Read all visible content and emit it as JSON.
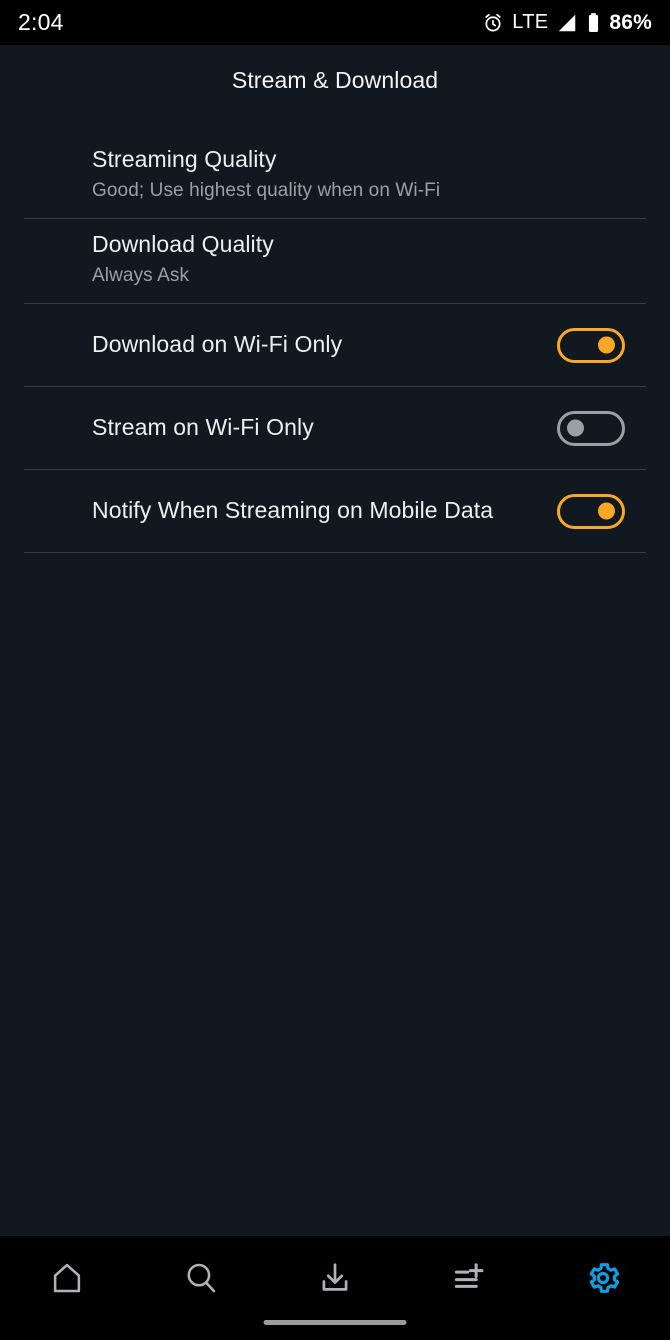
{
  "statusbar": {
    "time": "2:04",
    "alarm_icon": "alarm-clock-icon",
    "network": "LTE",
    "signal_icon": "signal-bars-icon",
    "battery_icon": "battery-icon",
    "battery_percent": "86%"
  },
  "header": {
    "title": "Stream & Download"
  },
  "settings": {
    "rows": [
      {
        "name": "streaming-quality",
        "title": "Streaming Quality",
        "subtitle": "Good; Use highest quality when on Wi-Fi",
        "type": "value"
      },
      {
        "name": "download-quality",
        "title": "Download Quality",
        "subtitle": "Always Ask",
        "type": "value"
      },
      {
        "name": "download-on-wifi-only",
        "title": "Download on Wi-Fi Only",
        "subtitle": "",
        "type": "switch",
        "state": "on"
      },
      {
        "name": "stream-on-wifi-only",
        "title": "Stream on Wi-Fi Only",
        "subtitle": "",
        "type": "switch",
        "state": "off"
      },
      {
        "name": "notify-streaming-mobile-data",
        "title": "Notify When Streaming on Mobile Data",
        "subtitle": "",
        "type": "switch",
        "state": "on"
      }
    ]
  },
  "bottom_nav": {
    "items": [
      {
        "name": "home",
        "icon": "home-icon",
        "active": false
      },
      {
        "name": "search",
        "icon": "search-icon",
        "active": false
      },
      {
        "name": "downloads",
        "icon": "download-icon",
        "active": false
      },
      {
        "name": "playlists",
        "icon": "playlist-add-icon",
        "active": false
      },
      {
        "name": "settings",
        "icon": "gear-icon",
        "active": true
      }
    ],
    "active_color": "#0b9fe3",
    "inactive_color": "#b0b3b6"
  },
  "colors": {
    "background": "#121820",
    "nav_background": "#000000",
    "accent_toggle_on": "#f9a825",
    "toggle_off": "#9aa0a6",
    "divider": "#363d45",
    "title_text": "#eceff2",
    "subtitle_text": "#9aa0a6"
  }
}
